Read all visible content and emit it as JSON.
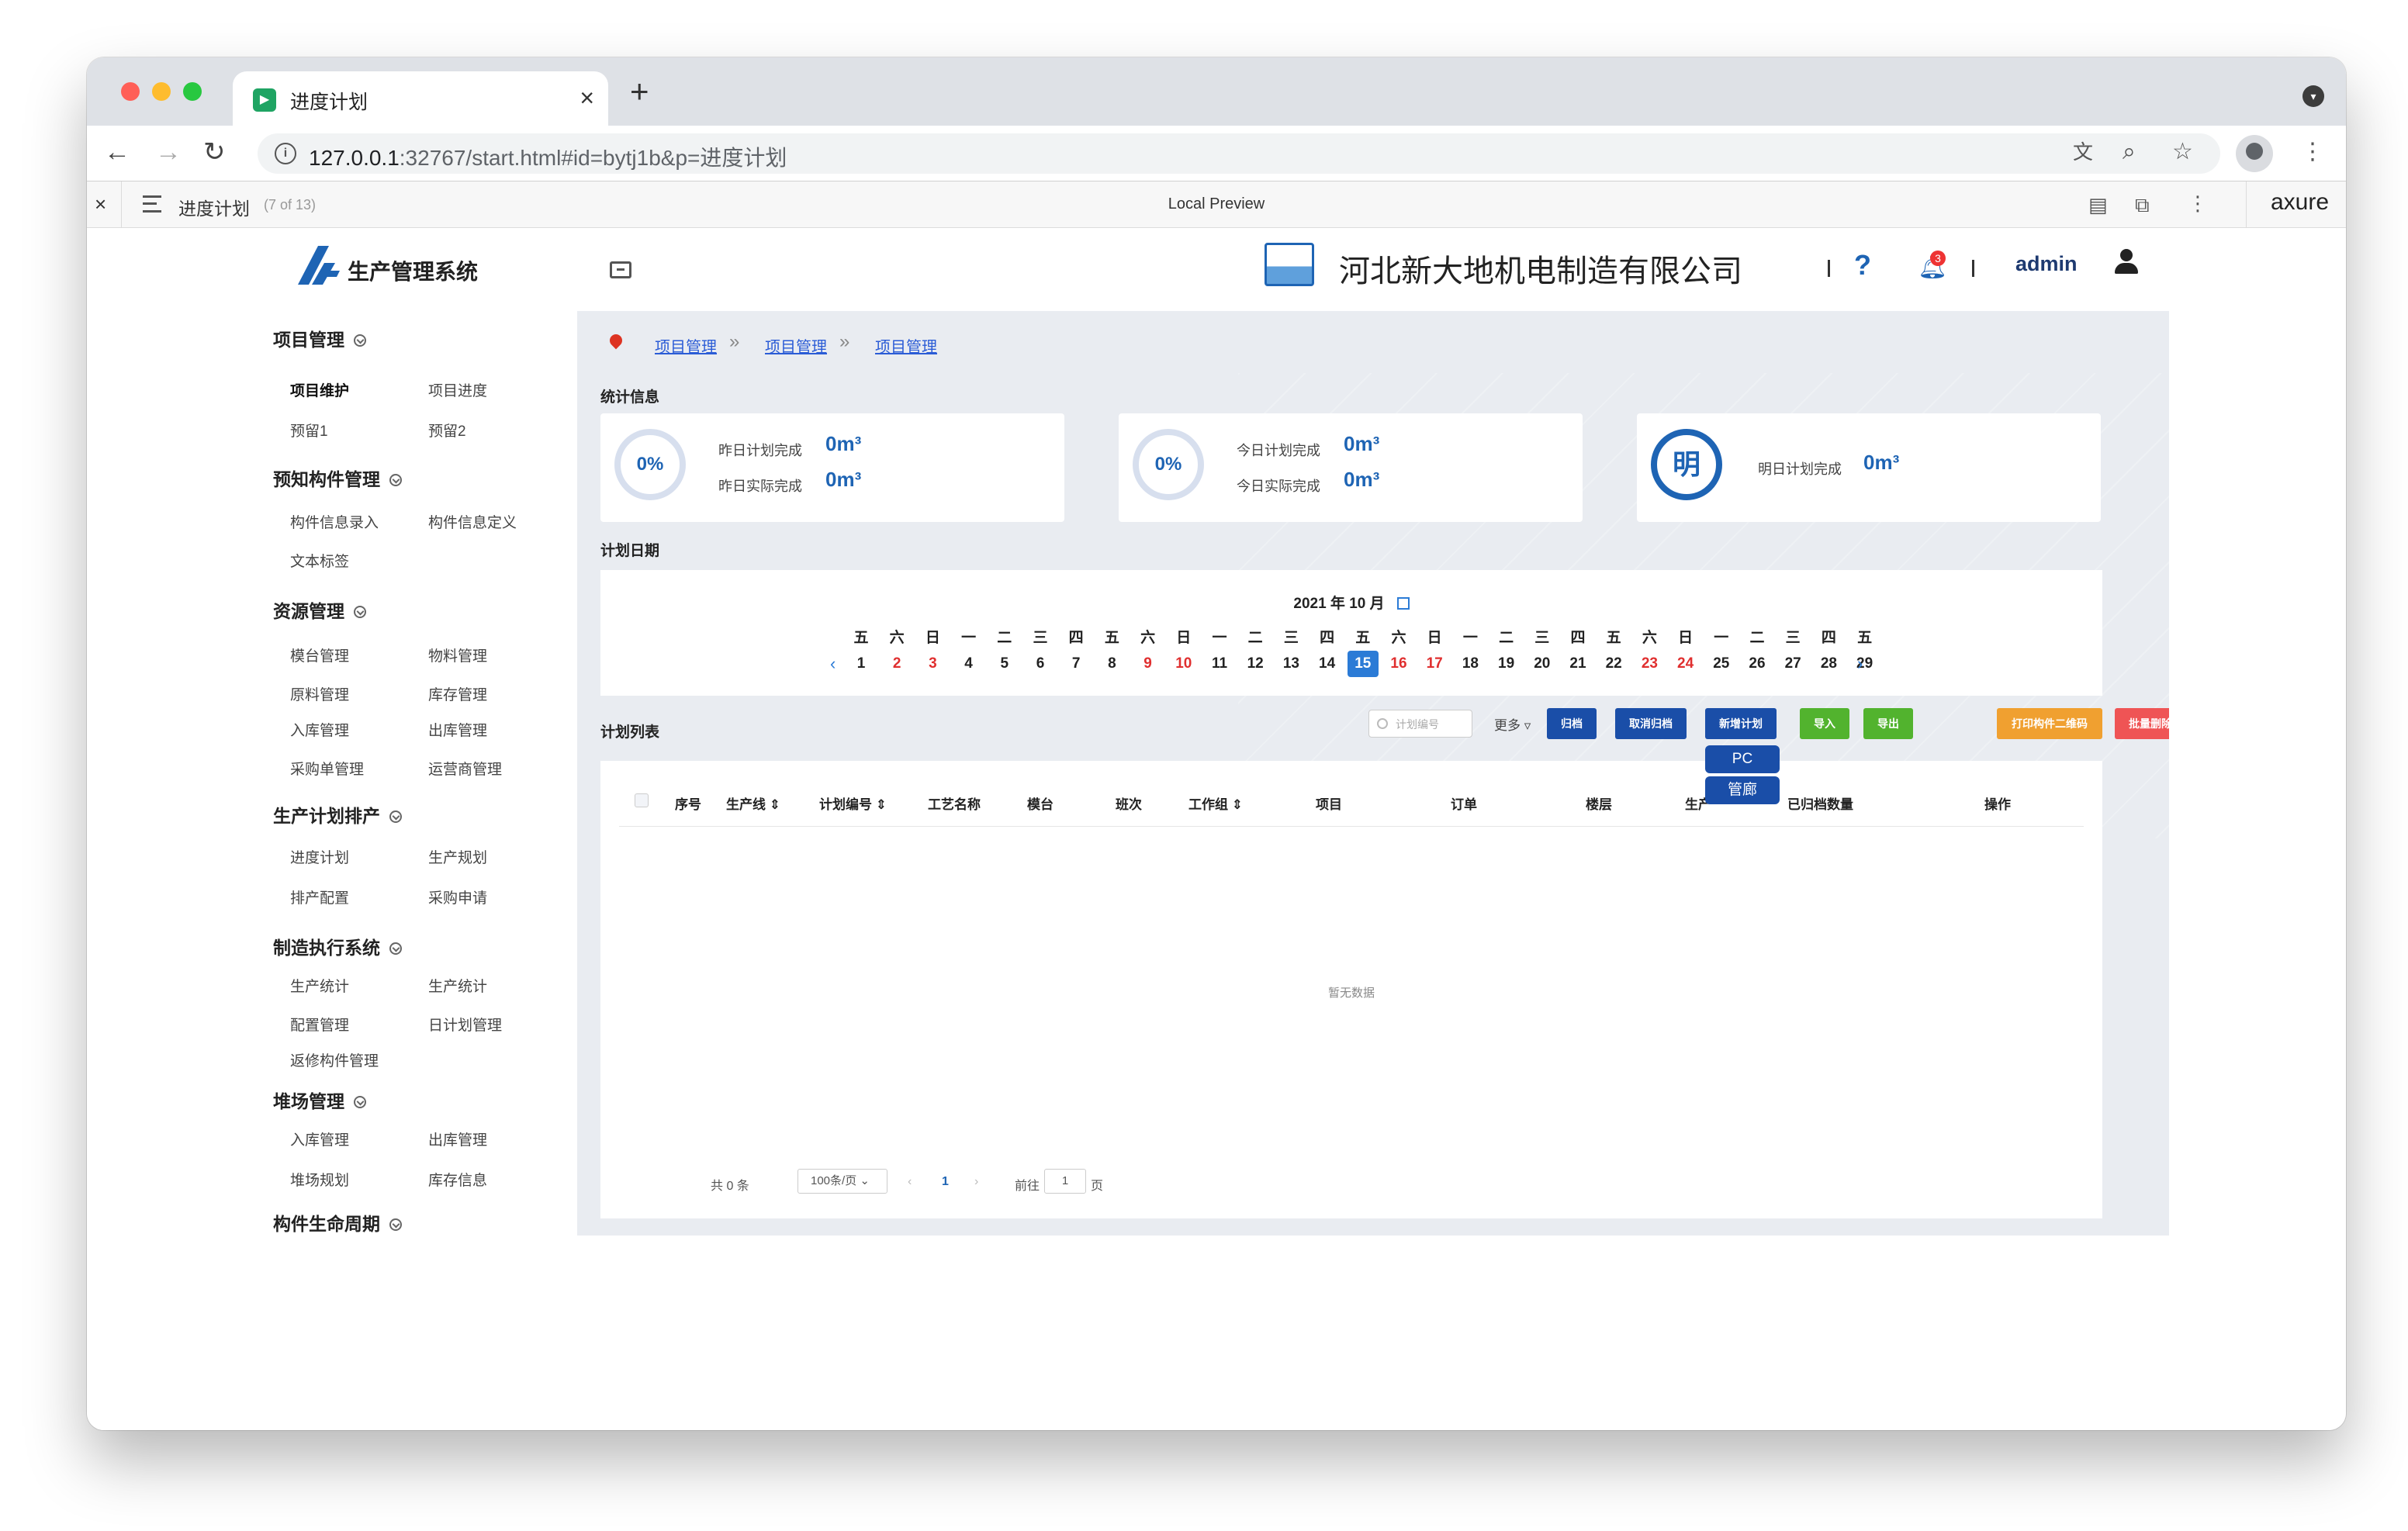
{
  "browser": {
    "tab_title": "进度计划",
    "url_host": "127.0.0.1",
    "url_path": ":32767/start.html#id=bytj1b&p=进度计划"
  },
  "axure": {
    "page_name": "进度计划",
    "page_count": "(7 of 13)",
    "center_label": "Local Preview",
    "logo": "axure"
  },
  "header": {
    "app_title": "生产管理系统",
    "company": "河北新大地机电制造有限公司",
    "help": "?",
    "notif_count": "3",
    "user": "admin"
  },
  "sidebar": {
    "groups": [
      {
        "title": "项目管理",
        "items": [
          "项目维护",
          "项目进度",
          "预留1",
          "预留2"
        ]
      },
      {
        "title": "预知构件管理",
        "items": [
          "构件信息录入",
          "构件信息定义",
          "文本标签"
        ]
      },
      {
        "title": "资源管理",
        "items": [
          "模台管理",
          "物料管理",
          "原料管理",
          "库存管理",
          "入库管理",
          "出库管理",
          "采购单管理",
          "运营商管理"
        ]
      },
      {
        "title": "生产计划排产",
        "items": [
          "进度计划",
          "生产规划",
          "排产配置",
          "采购申请"
        ]
      },
      {
        "title": "制造执行系统",
        "items": [
          "生产统计",
          "生产统计",
          "配置管理",
          "日计划管理",
          "返修构件管理"
        ]
      },
      {
        "title": "堆场管理",
        "items": [
          "入库管理",
          "出库管理",
          "堆场规划",
          "库存信息"
        ]
      },
      {
        "title": "构件生命周期",
        "items": []
      }
    ],
    "collapse_glyph": "《"
  },
  "main": {
    "breadcrumbs": [
      "项目管理",
      "项目管理",
      "项目管理"
    ],
    "crumb_sep": "»",
    "stats_title": "统计信息",
    "stats": [
      {
        "ring": "0%",
        "l1": "昨日计划完成",
        "v1": "0m³",
        "l2": "昨日实际完成",
        "v2": "0m³"
      },
      {
        "ring": "0%",
        "l1": "今日计划完成",
        "v1": "0m³",
        "l2": "今日实际完成",
        "v2": "0m³"
      },
      {
        "ring": "明",
        "l1": "明日计划完成",
        "v1": "0m³"
      }
    ],
    "plan_date_title": "计划日期",
    "calendar": {
      "title": "2021 年 10 月",
      "weekdays": [
        "五",
        "六",
        "日",
        "一",
        "二",
        "三",
        "四",
        "五",
        "六",
        "日",
        "一",
        "二",
        "三",
        "四",
        "五",
        "六",
        "日",
        "一",
        "二",
        "三",
        "四",
        "五",
        "六",
        "日",
        "一",
        "二",
        "三",
        "四",
        "五"
      ],
      "days": [
        "1",
        "2",
        "3",
        "4",
        "5",
        "6",
        "7",
        "8",
        "9",
        "10",
        "11",
        "12",
        "13",
        "14",
        "15",
        "16",
        "17",
        "18",
        "19",
        "20",
        "21",
        "22",
        "23",
        "24",
        "25",
        "26",
        "27",
        "28",
        "29"
      ],
      "selected_day": "15",
      "prev": "‹",
      "next": "›"
    },
    "list_title": "计划列表",
    "search_placeholder": "计划编号",
    "more_label": "更多",
    "buttons": [
      "归档",
      "取消归档",
      "新增计划",
      "导入",
      "导出",
      "打印构件二维码",
      "批量删除"
    ],
    "dropdown": [
      "PC",
      "管廊"
    ],
    "columns": [
      "序号",
      "生产线",
      "计划编号",
      "工艺名称",
      "模台",
      "班次",
      "工作组",
      "项目",
      "订单",
      "楼层",
      "生产",
      "已归档数量",
      "操作"
    ],
    "empty_text": "暂无数据",
    "pagination": {
      "total": "共 0 条",
      "page_size": "100条/页",
      "prev": "‹",
      "current": "1",
      "next": "›",
      "goto_label": "前往",
      "goto_value": "1",
      "goto_suffix": "页"
    }
  },
  "colors": {
    "primary": "#1e64b4",
    "btn_blue": "#1a4ea8",
    "btn_green": "#52b32e",
    "btn_orange": "#f0a030",
    "btn_red": "#ef5455",
    "weekend_red": "#e02f2f"
  }
}
